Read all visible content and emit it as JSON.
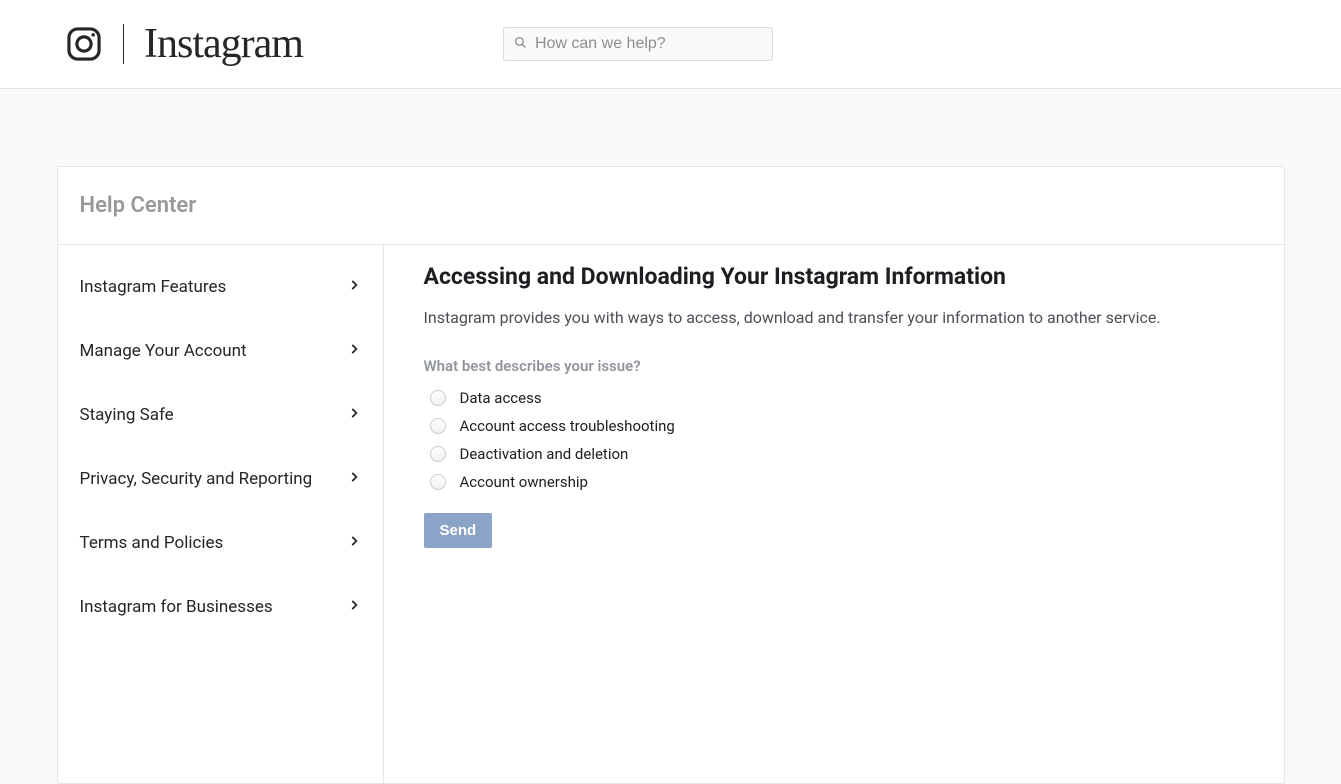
{
  "header": {
    "brand": "Instagram",
    "search_placeholder": "How can we help?"
  },
  "help_center": {
    "title": "Help Center"
  },
  "sidebar": {
    "items": [
      {
        "label": "Instagram Features"
      },
      {
        "label": "Manage Your Account"
      },
      {
        "label": "Staying Safe"
      },
      {
        "label": "Privacy, Security and Reporting"
      },
      {
        "label": "Terms and Policies"
      },
      {
        "label": "Instagram for Businesses"
      }
    ]
  },
  "article": {
    "title": "Accessing and Downloading Your Instagram Information",
    "intro": "Instagram provides you with ways to access, download and transfer your information to another service.",
    "question": "What best describes your issue?",
    "options": [
      {
        "label": "Data access"
      },
      {
        "label": "Account access troubleshooting"
      },
      {
        "label": "Deactivation and deletion"
      },
      {
        "label": "Account ownership"
      }
    ],
    "send_label": "Send"
  }
}
